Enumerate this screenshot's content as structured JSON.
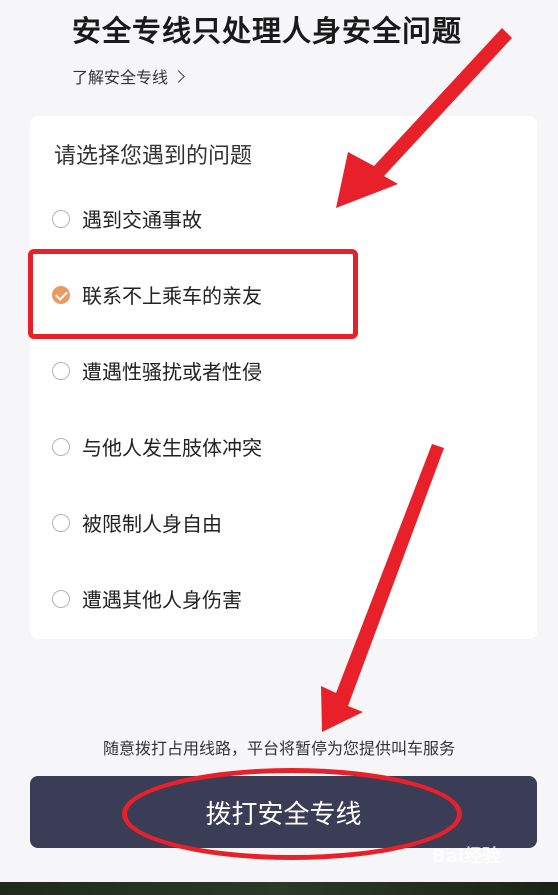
{
  "header": {
    "title": "安全专线只处理人身安全问题",
    "link_label": "了解安全专线"
  },
  "card": {
    "title": "请选择您遇到的问题",
    "options": [
      {
        "label": "遇到交通事故",
        "checked": false
      },
      {
        "label": "联系不上乘车的亲友",
        "checked": true
      },
      {
        "label": "遭遇性骚扰或者性侵",
        "checked": false
      },
      {
        "label": "与他人发生肢体冲突",
        "checked": false
      },
      {
        "label": "被限制人身自由",
        "checked": false
      },
      {
        "label": "遭遇其他人身伤害",
        "checked": false
      }
    ]
  },
  "footer": {
    "notice": "随意拨打占用线路，平台将暂停为您提供叫车服务",
    "call_button": "拨打安全专线"
  },
  "watermark": "Bai经验",
  "colors": {
    "accent_orange": "#ec9b5e",
    "button_bg": "#3b3c56",
    "annotation_red": "#e8202a"
  }
}
